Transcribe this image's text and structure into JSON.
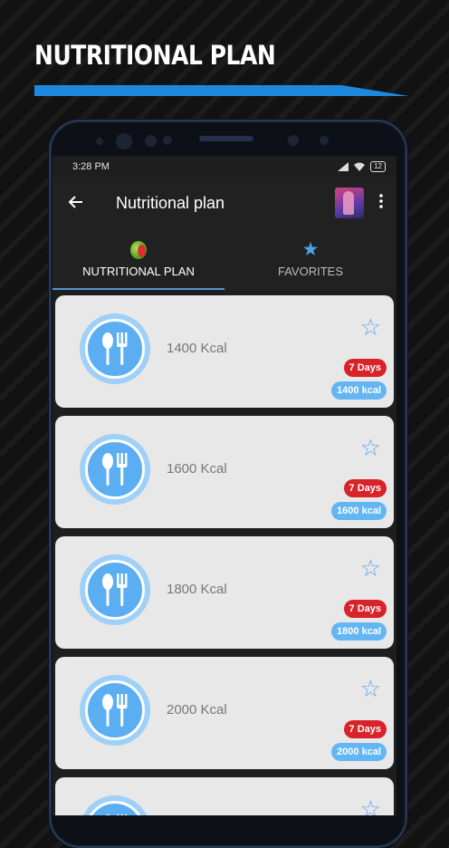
{
  "promo": {
    "title": "NUTRITIONAL PLAN"
  },
  "status": {
    "time": "3:28 PM",
    "battery": "12"
  },
  "appbar": {
    "title": "Nutritional plan",
    "back_icon": "arrow-left",
    "menu_icon": "more-vertical"
  },
  "tabs": [
    {
      "label": "NUTRITIONAL PLAN",
      "icon": "apple-icon",
      "active": true
    },
    {
      "label": "FAVORITES",
      "icon": "star-icon",
      "active": false
    }
  ],
  "plans": [
    {
      "title": "1400 Kcal",
      "days": "7 Days",
      "badge": "1400 kcal"
    },
    {
      "title": "1600 Kcal",
      "days": "7 Days",
      "badge": "1600 kcal"
    },
    {
      "title": "1800 Kcal",
      "days": "7 Days",
      "badge": "1800 kcal"
    },
    {
      "title": "2000 Kcal",
      "days": "7 Days",
      "badge": "2000 kcal"
    },
    {
      "title": "",
      "days": "",
      "badge": ""
    }
  ],
  "colors": {
    "accent": "#4d95d6",
    "days_badge": "#d8232a",
    "kcal_badge": "#63b6f3",
    "card": "#e8e8e8"
  }
}
